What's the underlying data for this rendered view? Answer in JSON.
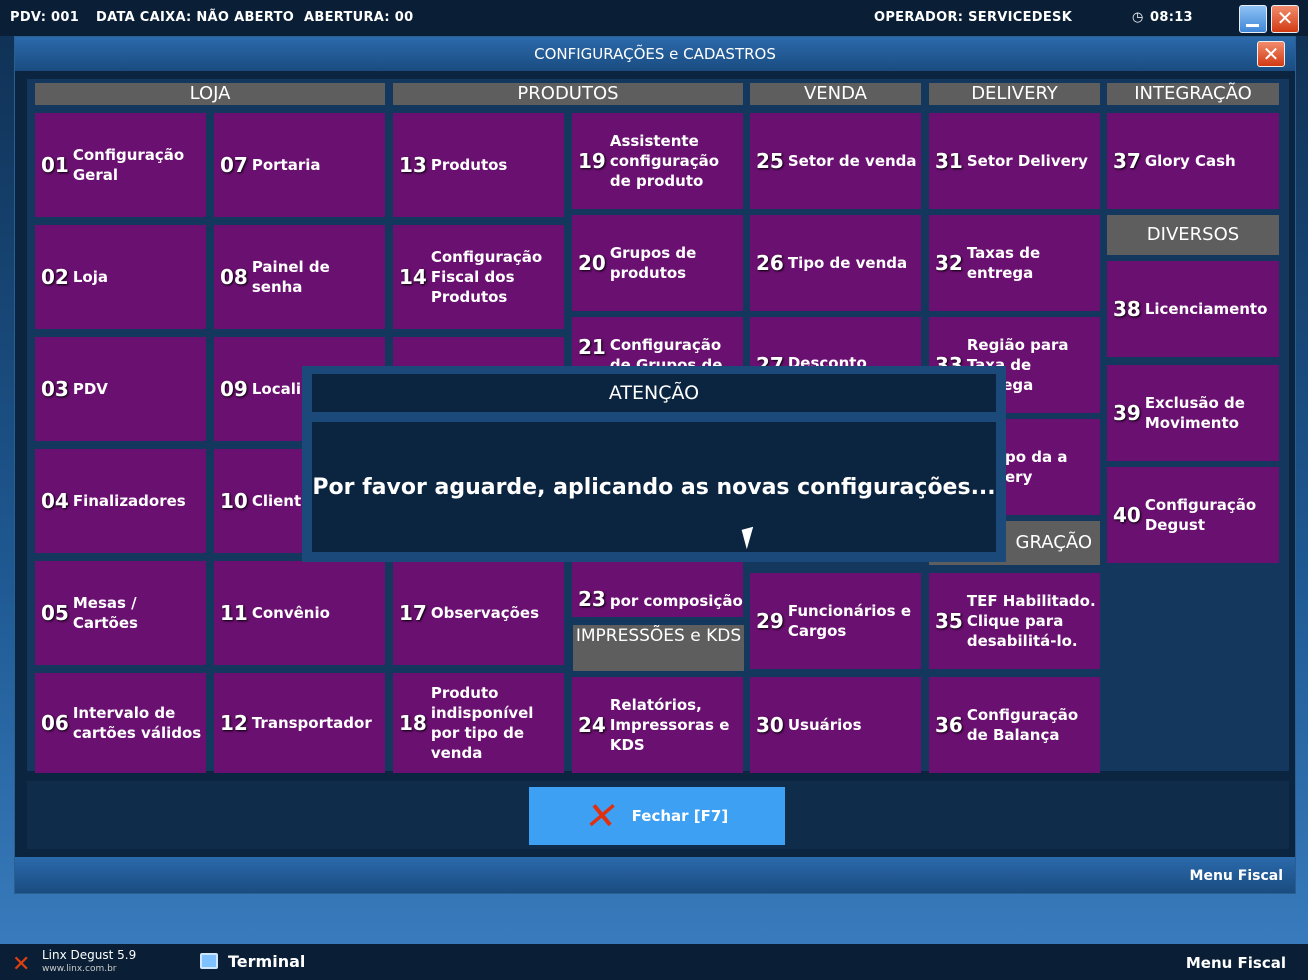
{
  "topbar": {
    "pdv": "PDV: 001",
    "data_caixa": "DATA CAIXA: NÃO ABERTO",
    "abertura": "ABERTURA: 00",
    "operador": "OPERADOR: SERVICEDESK",
    "time": "08:13",
    "clock_icon": "clock-icon"
  },
  "window": {
    "title": "CONFIGURAÇÕES e CADASTROS",
    "close_label": "✕"
  },
  "sections": {
    "loja": "LOJA",
    "produtos": "PRODUTOS",
    "venda": "VENDA",
    "delivery": "DELIVERY",
    "integracao": "INTEGRAÇÃO",
    "diversos": "DIVERSOS",
    "impressoes": "IMPRESSÕES e KDS",
    "integracao2": "GRAÇÃO"
  },
  "tiles": {
    "t01": {
      "num": "01",
      "label": "Configuração Geral"
    },
    "t02": {
      "num": "02",
      "label": "Loja"
    },
    "t03": {
      "num": "03",
      "label": "PDV"
    },
    "t04": {
      "num": "04",
      "label": "Finalizadores"
    },
    "t05": {
      "num": "05",
      "label": "Mesas / Cartões"
    },
    "t06": {
      "num": "06",
      "label": "Intervalo de cartões válidos"
    },
    "t07": {
      "num": "07",
      "label": "Portaria"
    },
    "t08": {
      "num": "08",
      "label": "Painel de senha"
    },
    "t09": {
      "num": "09",
      "label": "Locali"
    },
    "t10": {
      "num": "10",
      "label": "Client"
    },
    "t11": {
      "num": "11",
      "label": "Convênio"
    },
    "t12": {
      "num": "12",
      "label": "Transportador"
    },
    "t13": {
      "num": "13",
      "label": "Produtos"
    },
    "t14": {
      "num": "14",
      "label": "Configuração Fiscal dos Produtos"
    },
    "t17": {
      "num": "17",
      "label": "Observações"
    },
    "t18": {
      "num": "18",
      "label": "Produto indisponível por tipo de venda"
    },
    "t19": {
      "num": "19",
      "label": "Assistente configuração de produto"
    },
    "t20": {
      "num": "20",
      "label": "Grupos de produtos"
    },
    "t21": {
      "num": "21",
      "label": "Configuração de Grupos de"
    },
    "t23": {
      "num": "23",
      "label": "por composição"
    },
    "t24": {
      "num": "24",
      "label": "Relatórios, Impressoras e KDS"
    },
    "t25": {
      "num": "25",
      "label": "Setor de venda"
    },
    "t26": {
      "num": "26",
      "label": "Tipo de venda"
    },
    "t27": {
      "num": "27",
      "label": "Desconto"
    },
    "t29": {
      "num": "29",
      "label": "Funcionários e Cargos"
    },
    "t30": {
      "num": "30",
      "label": "Usuários"
    },
    "t31": {
      "num": "31",
      "label": "Setor Delivery"
    },
    "t32": {
      "num": "32",
      "label": "Taxas de entrega"
    },
    "t33": {
      "num": "33",
      "label": "Região para Taxa de entrega"
    },
    "t34": {
      "num": "",
      "label": "po da a ery"
    },
    "t35": {
      "num": "35",
      "label": "TEF Habilitado. Clique para desabilitá-lo."
    },
    "t36": {
      "num": "36",
      "label": "Configuração de Balança"
    },
    "t37": {
      "num": "37",
      "label": "Glory Cash"
    },
    "t38": {
      "num": "38",
      "label": "Licenciamento"
    },
    "t39": {
      "num": "39",
      "label": "Exclusão de Movimento"
    },
    "t40": {
      "num": "40",
      "label": "Configuração Degust"
    }
  },
  "fechar": {
    "label": "Fechar [F7]"
  },
  "menu_fiscal": "Menu Fiscal",
  "dialog": {
    "title": "ATENÇÃO",
    "message": "Por favor aguarde, aplicando as novas configurações..."
  },
  "taskbar": {
    "app_name": "Linx Degust 5.9",
    "app_url": "www.linx.com.br",
    "terminal": "Terminal",
    "menu_fiscal": "Menu Fiscal"
  },
  "colors": {
    "tile": "#6a1070",
    "section_header": "#5e5e5e",
    "fechar_button": "#3da0f2",
    "close_button": "#d23a13"
  }
}
